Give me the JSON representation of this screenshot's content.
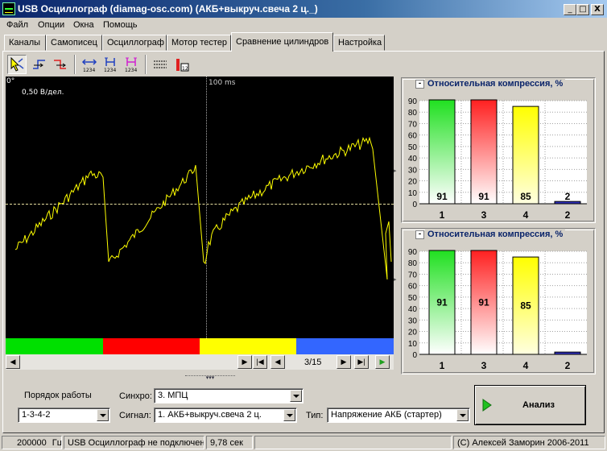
{
  "window": {
    "title": "USB Осциллограф (diamag-osc.com) (АКБ+выкруч.свеча 2 ц._)",
    "minimize": "_",
    "maximize": "□",
    "close": "X"
  },
  "menu": [
    "Файл",
    "Опции",
    "Окна",
    "Помощь"
  ],
  "tabs": [
    "Каналы",
    "Самописец",
    "Осциллограф",
    "Мотор тестер",
    "Сравнение цилиндров",
    "Настройка"
  ],
  "active_tab": "Сравнение цилиндров",
  "toolbar": {
    "icons": [
      "cursor-select-icon",
      "rising-edge-icon",
      "falling-edge-icon",
      "measure-1234-icon",
      "marker-blue-1234-icon",
      "marker-magenta-1234-icon",
      "grid-lines-icon",
      "bar-chart-icon"
    ],
    "labels": [
      "1234",
      "1234",
      "1234"
    ]
  },
  "scope": {
    "angle_label": "0°",
    "time_label": "100 ms",
    "scale_label": "0,50 В/дел.",
    "trace_color": "#ffff00",
    "background": "#000000",
    "cylinder_colors": [
      "#00e000",
      "#ff0000",
      "#ffff00",
      "#3366ff"
    ]
  },
  "scroll": {
    "page_indicator": "3/15"
  },
  "compression_top": {
    "title": "Относительная компрессия, %"
  },
  "compression_bottom": {
    "title": "Относительная компрессия, %"
  },
  "chart_data": [
    {
      "type": "bar",
      "title": "Относительная компрессия, %",
      "categories": [
        "1",
        "3",
        "4",
        "2"
      ],
      "values": [
        91,
        91,
        85,
        2
      ],
      "colors": [
        "#20e020",
        "#ff2020",
        "#ffff00",
        "#3030c0"
      ],
      "ylim": [
        0,
        90
      ],
      "yticks": [
        0,
        10,
        20,
        30,
        40,
        50,
        60,
        70,
        80,
        90
      ],
      "value_labels": [
        "91",
        "91",
        "85",
        "2"
      ],
      "label_position": "bottom"
    },
    {
      "type": "bar",
      "title": "Относительная компрессия, %",
      "categories": [
        "1",
        "3",
        "4",
        "2"
      ],
      "values": [
        91,
        91,
        85,
        2
      ],
      "colors": [
        "#20e020",
        "#ff2020",
        "#ffff00",
        "#3030c0"
      ],
      "ylim": [
        0,
        90
      ],
      "yticks": [
        0,
        10,
        20,
        30,
        40,
        50,
        60,
        70,
        80,
        90
      ],
      "value_labels": [
        "91",
        "91",
        "85",
        ""
      ],
      "label_position": "middle"
    }
  ],
  "controls": {
    "firing_order_label": "Порядок работы",
    "firing_order_value": "1-3-4-2",
    "sync_label": "Синхро:",
    "sync_value": "3.  МПЦ",
    "signal_label": "Сигнал:",
    "signal_value": "1.  АКБ+выкруч.свеча 2 ц.",
    "type_label": "Тип:",
    "type_value": "Напряжение АКБ (стартер)",
    "analyze_button": "Анализ"
  },
  "status": {
    "rate": "200000",
    "rate_unit": "Гц",
    "connection": "USB Осциллограф не подключен",
    "duration": "9,78 сек",
    "copyright": "(С) Алексей Заморин 2006-2011"
  }
}
